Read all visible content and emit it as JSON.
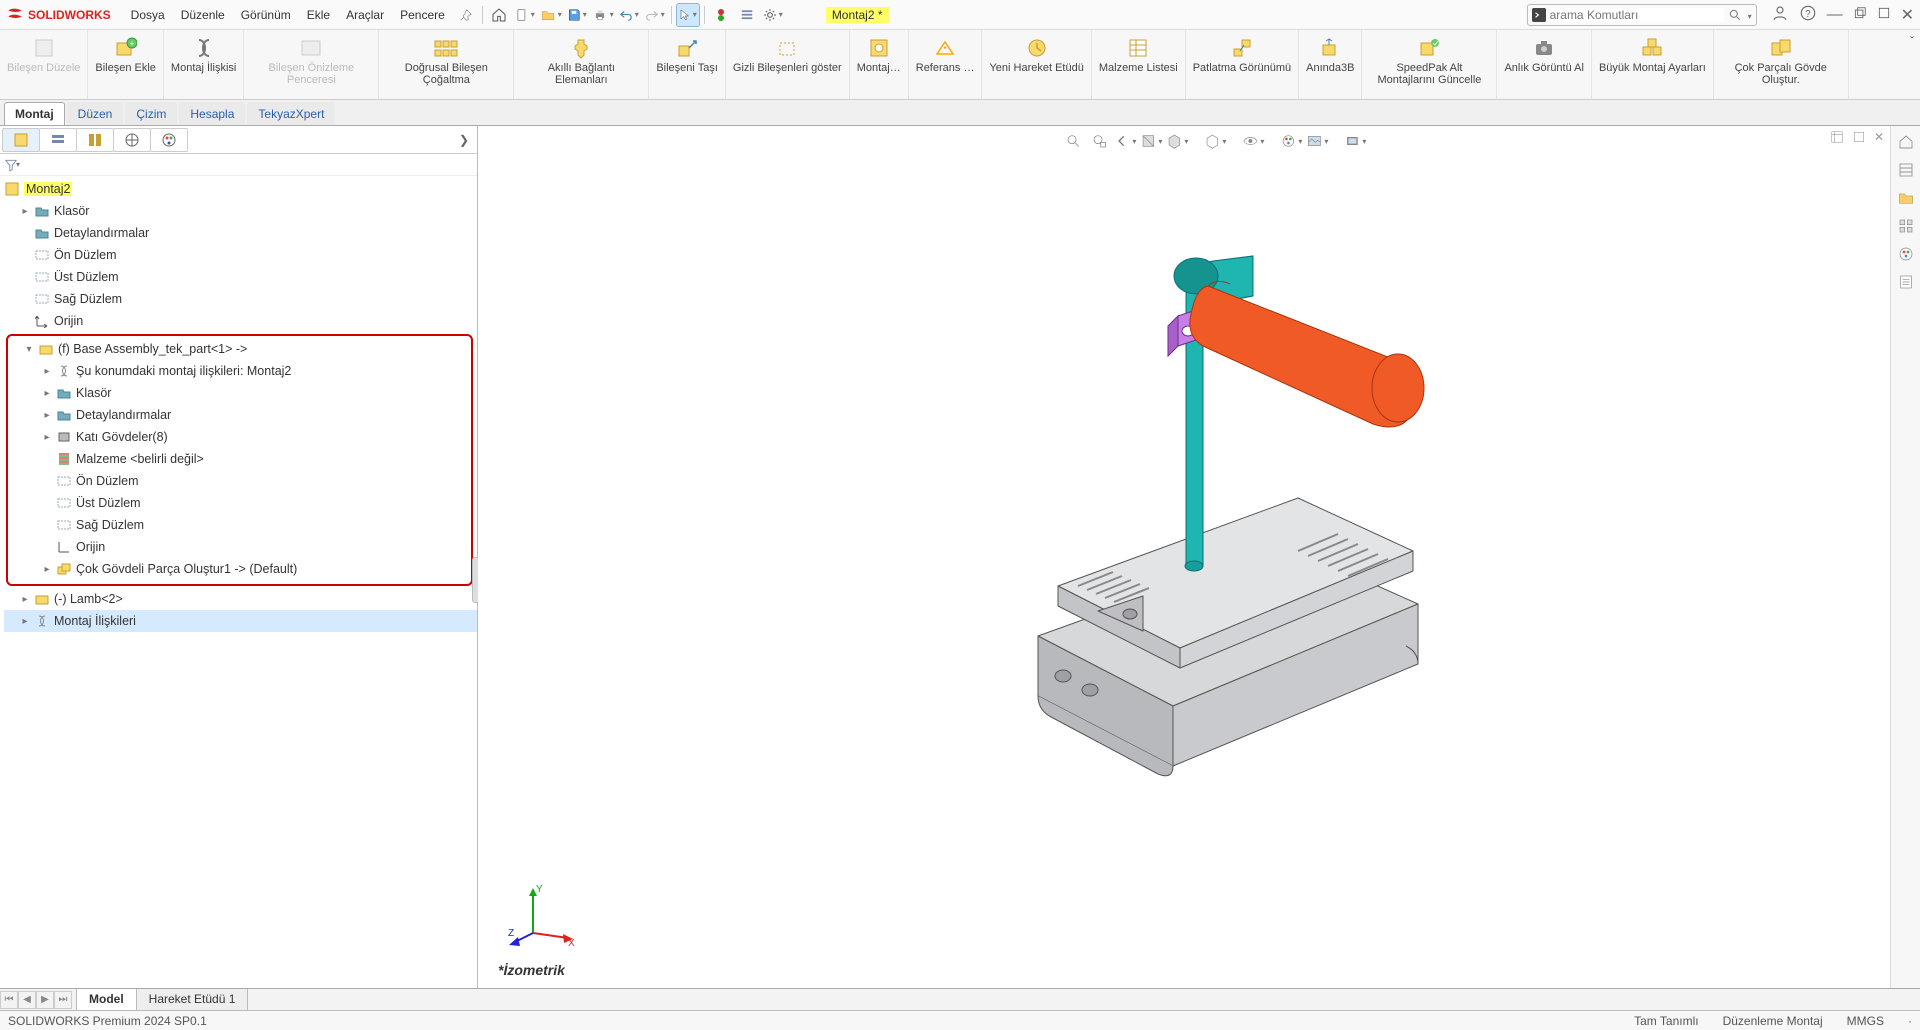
{
  "app": {
    "name": "SOLIDWORKS"
  },
  "menus": [
    "Dosya",
    "Düzenle",
    "Görünüm",
    "Ekle",
    "Araçlar",
    "Pencere"
  ],
  "document": {
    "name": "Montaj2 *"
  },
  "search": {
    "placeholder": "arama Komutları"
  },
  "ribbon": [
    {
      "label": "Bileşen Düzele",
      "disabled": true
    },
    {
      "label": "Bileşen Ekle"
    },
    {
      "label": "Montaj İlişkisi"
    },
    {
      "label": "Bileşen Önizleme Penceresi",
      "disabled": true
    },
    {
      "label": "Doğrusal Bileşen Çoğaltma"
    },
    {
      "label": "Akıllı Bağlantı Elemanları"
    },
    {
      "label": "Bileşeni Taşı"
    },
    {
      "label": "Gizli Bileşenleri göster"
    },
    {
      "label": "Montaj…"
    },
    {
      "label": "Referans …"
    },
    {
      "label": "Yeni Hareket Etüdü"
    },
    {
      "label": "Malzeme Listesi"
    },
    {
      "label": "Patlatma Görünümü"
    },
    {
      "label": "Anında3B"
    },
    {
      "label": "SpeedPak Alt Montajlarını Güncelle"
    },
    {
      "label": "Anlık Görüntü Al"
    },
    {
      "label": "Büyük Montaj Ayarları"
    },
    {
      "label": "Çok Parçalı Gövde Oluştur."
    }
  ],
  "ribbonTabs": [
    "Montaj",
    "Düzen",
    "Çizim",
    "Hesapla",
    "TekyazXpert"
  ],
  "tree": {
    "root": "Montaj2",
    "items": [
      {
        "label": "Klasör",
        "icon": "folder",
        "caret": true
      },
      {
        "label": "Detaylandırmalar",
        "icon": "folder"
      },
      {
        "label": "Ön Düzlem",
        "icon": "plane"
      },
      {
        "label": "Üst Düzlem",
        "icon": "plane"
      },
      {
        "label": "Sağ Düzlem",
        "icon": "plane"
      },
      {
        "label": "Orijin",
        "icon": "origin"
      }
    ],
    "part": {
      "label": "(f) Base Assembly_tek_part<1> ->",
      "children": [
        {
          "label": "Şu konumdaki montaj ilişkileri: Montaj2",
          "icon": "mates",
          "caret": true
        },
        {
          "label": "Klasör",
          "icon": "folder",
          "caret": true
        },
        {
          "label": "Detaylandırmalar",
          "icon": "folder",
          "caret": true
        },
        {
          "label": "Katı Gövdeler(8)",
          "icon": "body",
          "caret": true
        },
        {
          "label": "Malzeme <belirli değil>",
          "icon": "material"
        },
        {
          "label": "Ön Düzlem",
          "icon": "plane"
        },
        {
          "label": "Üst Düzlem",
          "icon": "plane"
        },
        {
          "label": "Sağ Düzlem",
          "icon": "plane"
        },
        {
          "label": "Orijin",
          "icon": "origin"
        },
        {
          "label": "Çok Gövdeli Parça Oluştur1 -> (Default)",
          "icon": "feature",
          "caret": true
        }
      ]
    },
    "after": [
      {
        "label": "(-) Lamb<2>",
        "icon": "part",
        "caret": true
      },
      {
        "label": "Montaj İlişkileri",
        "icon": "mates",
        "caret": true
      }
    ]
  },
  "viewLabel": "*İzometrik",
  "bottomTabs": [
    "Model",
    "Hareket Etüdü 1"
  ],
  "status": {
    "left": "SOLIDWORKS Premium 2024 SP0.1",
    "right": [
      "Tam Tanımlı",
      "Düzenleme Montaj",
      "MMGS",
      "·"
    ]
  }
}
